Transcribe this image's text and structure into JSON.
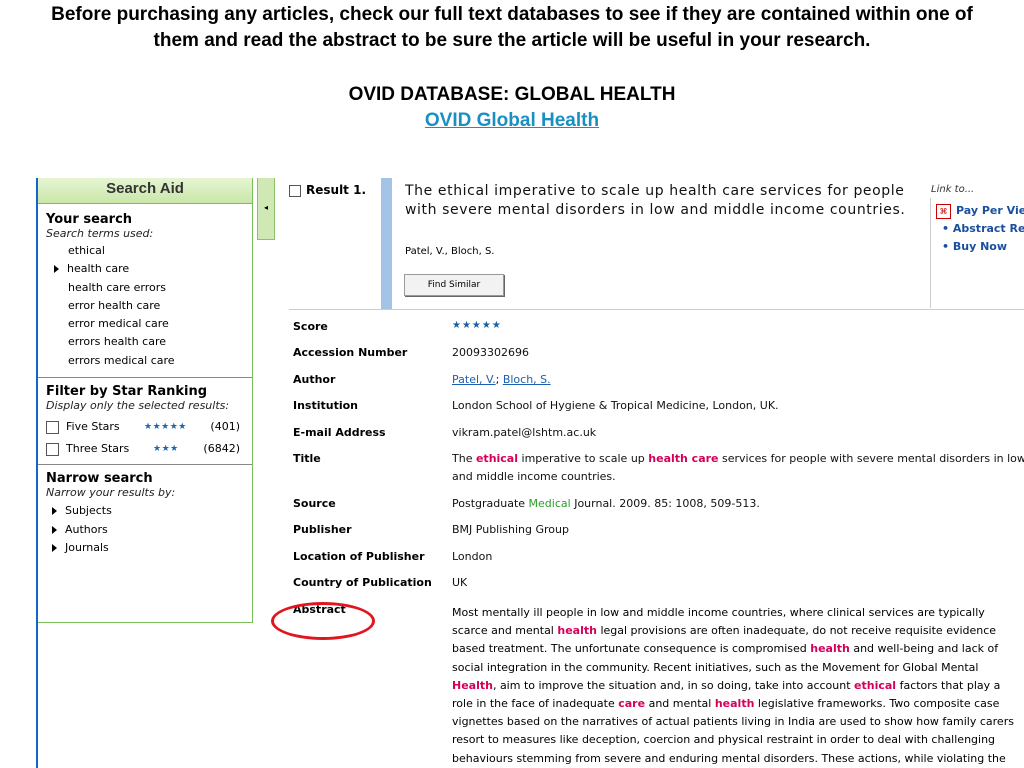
{
  "header": {
    "intro": "Before purchasing any articles, check our full text databases to see if they are contained within one of them and read the abstract to be sure the article will be useful in your research.",
    "db_title": "OVID DATABASE: GLOBAL HEALTH",
    "db_link": "OVID Global Health"
  },
  "search_aid": {
    "title": "Search Aid",
    "your_search": "Your search",
    "terms_used": "Search terms used:",
    "terms": [
      "ethical",
      "health care",
      "health care errors",
      "error health care",
      "error medical care",
      "errors health care",
      "errors medical care"
    ],
    "filter_title": "Filter by Star Ranking",
    "filter_sub": "Display only the selected results:",
    "filters": [
      {
        "label": "Five Stars",
        "stars": "★★★★★",
        "count": "(401)"
      },
      {
        "label": "Three Stars",
        "stars": "★★★",
        "count": "(6842)"
      }
    ],
    "narrow_title": "Narrow search",
    "narrow_sub": "Narrow your results by:",
    "narrow_items": [
      "Subjects",
      "Authors",
      "Journals"
    ],
    "collapse_glyph": "◂"
  },
  "result": {
    "label": "Result 1.",
    "title": "The ethical imperative to scale up health care services for people with severe mental disorders in low and middle income countries.",
    "authors": "Patel, V., Bloch, S.",
    "find_similar": "Find Similar",
    "link_to": "Link to...",
    "links": [
      "Pay Per View",
      "Abstract Re",
      "Buy Now"
    ]
  },
  "details": {
    "score_label": "Score",
    "score_stars": "★★★★★",
    "accession_label": "Accession Number",
    "accession": "20093302696",
    "author_label": "Author",
    "author1": "Patel, V.",
    "author2": "Bloch, S.",
    "institution_label": "Institution",
    "institution": "London School of Hygiene & Tropical Medicine, London, UK.",
    "email_label": "E-mail Address",
    "email": "vikram.patel@lshtm.ac.uk",
    "title_label": "Title",
    "title_parts": [
      "The ",
      "ethical",
      " imperative to scale up ",
      "health care",
      " services for people with severe mental disorders in low and middle income countries."
    ],
    "source_label": "Source",
    "source_parts": [
      "Postgraduate ",
      "Medical",
      " Journal. 2009. 85: 1008, 509-513."
    ],
    "publisher_label": "Publisher",
    "publisher": "BMJ Publishing Group",
    "location_label": "Location of Publisher",
    "location": "London",
    "country_label": "Country of Publication",
    "country": "UK",
    "abstract_label": "Abstract"
  },
  "abstract_lines": [
    [
      [
        "Most mentally ill people in low and middle income countries, where clinical services are typically",
        0
      ]
    ],
    [
      [
        "scarce and mental ",
        0
      ],
      [
        "health",
        1
      ],
      [
        " legal provisions are often inadequate, do not receive requisite evidence",
        0
      ]
    ],
    [
      [
        "based treatment. The unfortunate consequence is compromised ",
        0
      ],
      [
        "health",
        1
      ],
      [
        " and well-being and lack of",
        0
      ]
    ],
    [
      [
        "social integration in the community. Recent initiatives, such as the Movement for Global Mental",
        0
      ]
    ],
    [
      [
        "Health",
        1
      ],
      [
        ", aim to improve the situation and, in so doing, take into account ",
        0
      ],
      [
        "ethical",
        1
      ],
      [
        " factors that play a",
        0
      ]
    ],
    [
      [
        "role in the face of inadequate ",
        0
      ],
      [
        "care",
        1
      ],
      [
        " and mental ",
        0
      ],
      [
        "health",
        1
      ],
      [
        " legislative frameworks. Two composite case",
        0
      ]
    ],
    [
      [
        "vignettes based on the narratives of actual patients living in India are used to show how family carers",
        0
      ]
    ],
    [
      [
        "resort to measures like deception, coercion and physical restraint in order to deal with challenging",
        0
      ]
    ],
    [
      [
        "behaviours stemming from severe and enduring mental disorders. These actions, while violating the",
        0
      ]
    ]
  ]
}
